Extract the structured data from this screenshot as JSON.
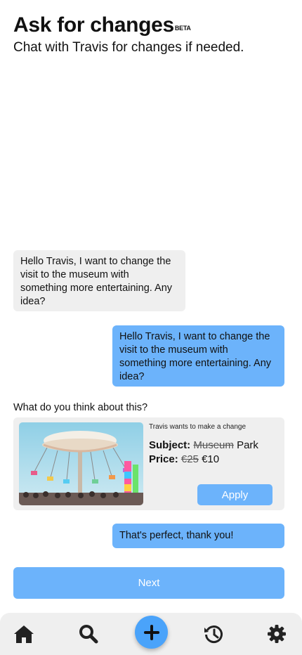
{
  "header": {
    "title": "Ask for changes",
    "badge": "BETA",
    "subtitle": "Chat with Travis for changes if needed."
  },
  "chat": {
    "messages": [
      {
        "side": "incoming",
        "text": "Hello Travis, I want to change the visit to the museum with something more entertaining. Any idea?"
      },
      {
        "side": "outgoing",
        "text": "Hello Travis, I want to change the visit to the museum with something more entertaining. Any idea?"
      }
    ],
    "prompt": "What do you think about this?",
    "proposal": {
      "note": "Travis wants to make a change",
      "subject_label": "Subject:",
      "subject_old": "Museum",
      "subject_new": "Park",
      "price_label": "Price:",
      "price_old": "€25",
      "price_new": "€10",
      "image_icon": "carousel-photo",
      "apply_label": "Apply"
    },
    "reply": "That's perfect, thank you!"
  },
  "next_label": "Next",
  "nav": {
    "items": [
      "home-icon",
      "search-icon",
      "add-icon",
      "history-icon",
      "gear-icon"
    ]
  },
  "colors": {
    "accent": "#6cb3fb",
    "fab": "#4aa3fa",
    "bubble_incoming": "#efefef",
    "navbar": "#efefef"
  }
}
